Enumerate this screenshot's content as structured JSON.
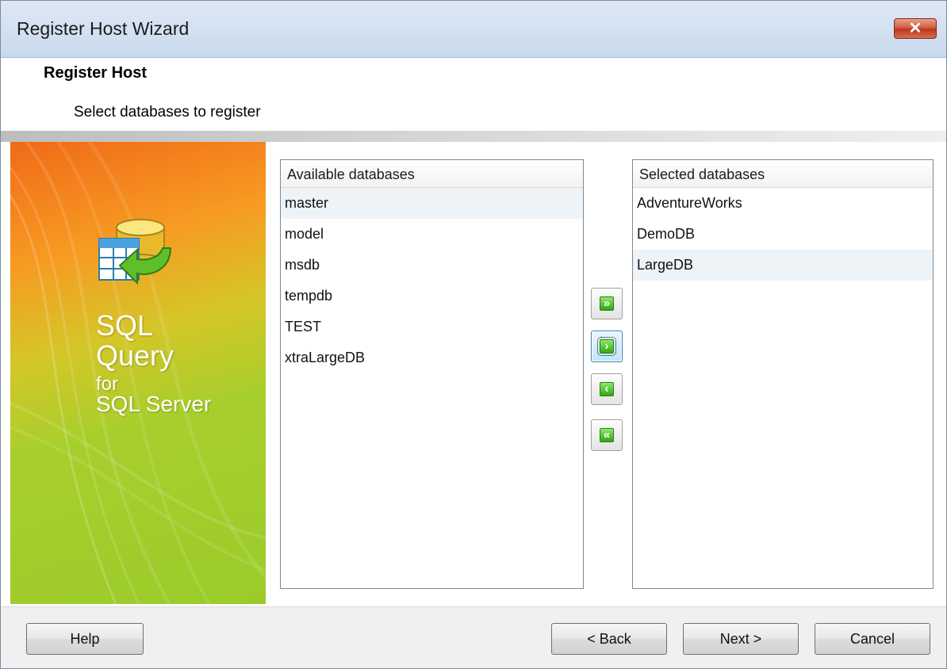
{
  "window": {
    "title": "Register Host Wizard",
    "close_glyph": "✕"
  },
  "header": {
    "title": "Register Host",
    "subtitle": "Select databases to register"
  },
  "banner": {
    "line1": "SQL",
    "line2": "Query",
    "line3": "for",
    "line4": "SQL Server",
    "icon": "database-import-icon"
  },
  "available": {
    "header": "Available databases",
    "items": [
      "master",
      "model",
      "msdb",
      "tempdb",
      "TEST",
      "xtraLargeDB"
    ],
    "highlighted": "master"
  },
  "selected": {
    "header": "Selected databases",
    "items": [
      "AdventureWorks",
      "DemoDB",
      "LargeDB"
    ],
    "highlighted": "LargeDB"
  },
  "movers": {
    "add_all": "»",
    "add": "›",
    "remove": "‹",
    "remove_all": "«"
  },
  "buttons": {
    "help": "Help",
    "back": "< Back",
    "next": "Next >",
    "cancel": "Cancel"
  },
  "colors": {
    "accent_green": "#33a616",
    "banner_orange": "#f06a18",
    "banner_green": "#9bcb2a",
    "selection_bg": "#eef3f8"
  }
}
